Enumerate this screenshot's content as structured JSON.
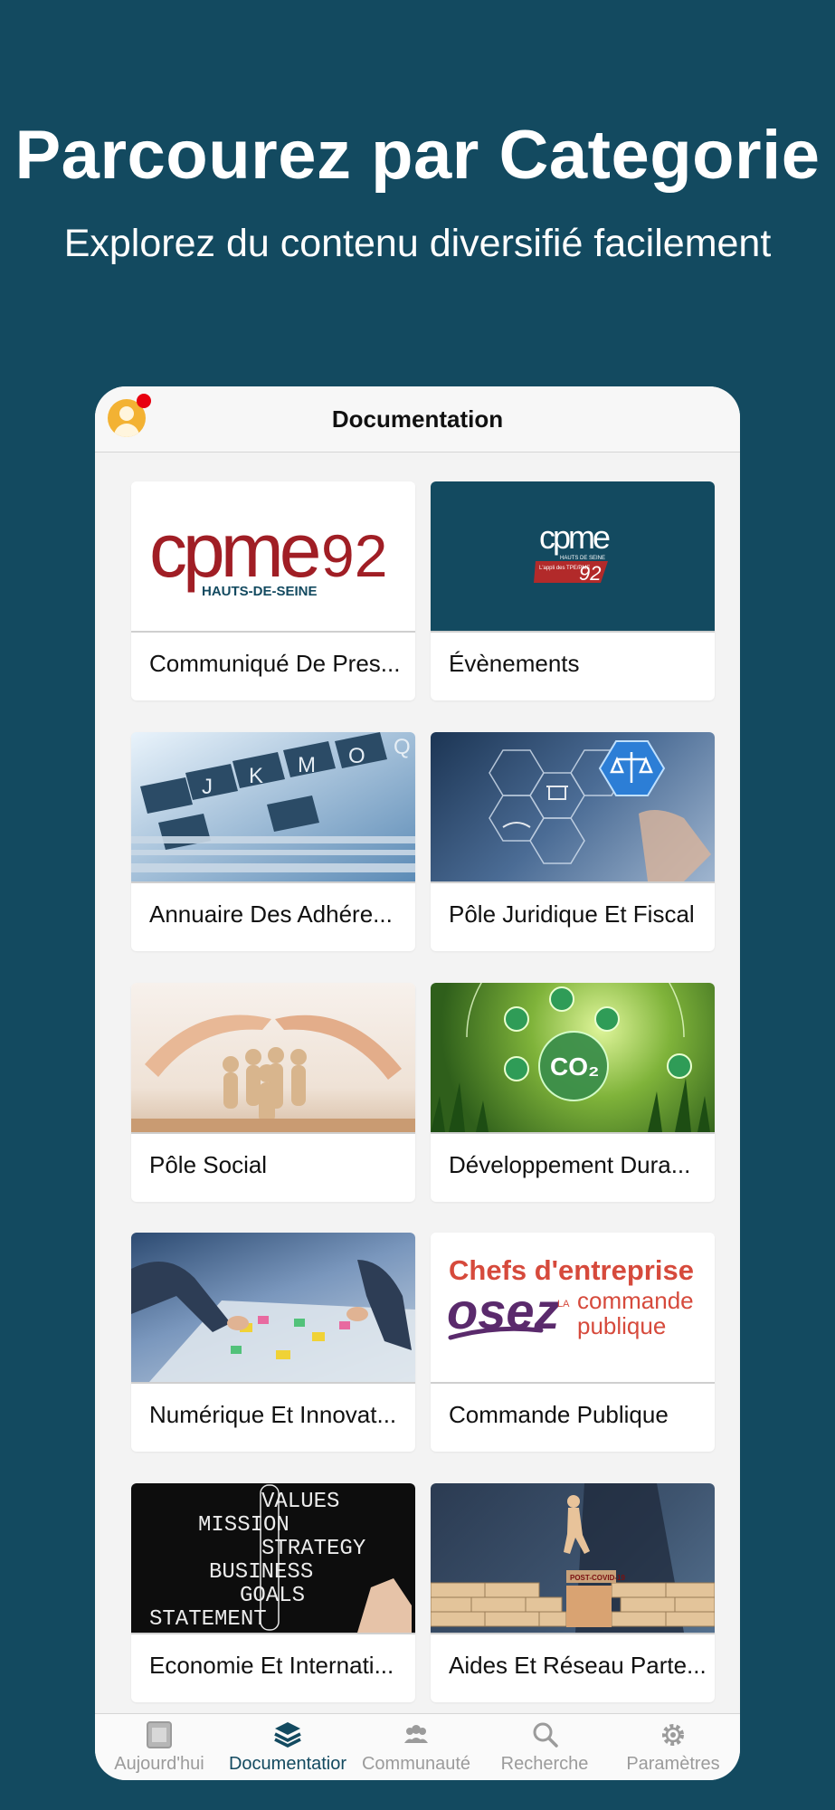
{
  "hero": {
    "title": "Parcourez par Categorie",
    "subtitle": "Explorez du contenu diversifié facilement"
  },
  "app": {
    "title": "Documentation",
    "avatar_icon": "user-avatar-icon",
    "notification_color": "#e8000f"
  },
  "cards": [
    {
      "label": "Communiqué De Pres...",
      "image": "cpme92-logo",
      "logo_text": "cpme",
      "logo_number": "92",
      "logo_sub": "HAUTS-DE-SEINE"
    },
    {
      "label": "Évènements",
      "image": "cpme92-app-logo",
      "logo_text": "cpme",
      "logo_sub": "HAUTS DE SEINE",
      "badge_text": "L'appli des TPE/PME",
      "badge_number": "92"
    },
    {
      "label": "Annuaire Des Adhére...",
      "image": "file-index-tabs-photo",
      "letters": [
        "J",
        "K",
        "M",
        "O",
        "Q"
      ]
    },
    {
      "label": "Pôle Juridique Et Fiscal",
      "image": "legal-icons-hexagon-photo"
    },
    {
      "label": "Pôle Social",
      "image": "hands-protecting-figures-photo"
    },
    {
      "label": "Développement Dura...",
      "image": "co2-globe-grass-photo",
      "co2_text": "CO₂"
    },
    {
      "label": "Numérique Et Innovat...",
      "image": "team-planning-table-photo"
    },
    {
      "label": "Commande Publique",
      "image": "osez-commande-publique-logo",
      "line1": "Chefs d'entreprise",
      "line2": "osez",
      "line3a": "LA",
      "line3b": "commande",
      "line4": "publique"
    },
    {
      "label": "Economie Et Internati...",
      "image": "chalkboard-mission-vision-photo",
      "words": [
        "VALUES",
        "MISSION",
        "STRATEGY",
        "BUSINESS",
        "GOALS",
        "STATEMENT"
      ]
    },
    {
      "label": "Aides Et Réseau Parte...",
      "image": "post-covid-blocks-photo",
      "sign_text": "POST-COVID-19"
    }
  ],
  "tabs": [
    {
      "label": "Aujourd'hui",
      "icon": "today-icon",
      "active": false
    },
    {
      "label": "Documentatior",
      "icon": "layers-icon",
      "active": true
    },
    {
      "label": "Communauté",
      "icon": "community-icon",
      "active": false
    },
    {
      "label": "Recherche",
      "icon": "search-icon",
      "active": false
    },
    {
      "label": "Paramètres",
      "icon": "gear-icon",
      "active": false
    }
  ],
  "colors": {
    "background": "#134a60",
    "active_tab": "#134a60",
    "inactive_tab": "#9b9b9b",
    "avatar": "#f3b233"
  }
}
